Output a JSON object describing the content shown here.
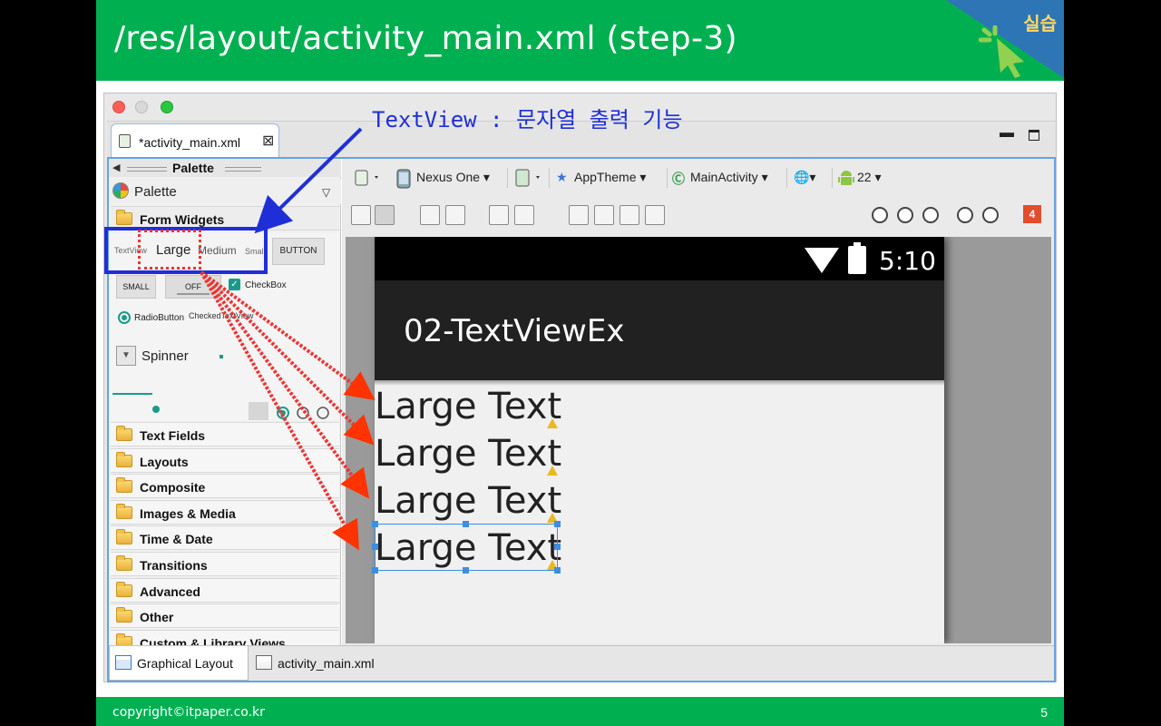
{
  "slide": {
    "title": "/res/layout/activity_main.xml (step-3)",
    "corner_label": "실습",
    "footer_copyright": "copyright©itpaper.co.kr",
    "page_number": "5",
    "annotation_label": "TextView : 문자열 출력 기능",
    "colors": {
      "title_bar": "#00b050",
      "annotation_blue": "#1f2fd8",
      "annotation_red": "#e33333"
    }
  },
  "window": {
    "editor_tab": "*activity_main.xml",
    "palette": {
      "header": "Palette",
      "dropdown": "Palette",
      "form_widgets": "Form Widgets",
      "widgets": {
        "textview": "TextView",
        "large": "Large",
        "medium": "Medium",
        "small": "Small",
        "button": "BUTTON",
        "small_button": "SMALL",
        "toggle": "OFF",
        "checkbox": "CheckBox",
        "radio": "RadioButton",
        "checked_text_view": "CheckedTextView",
        "spinner": "Spinner"
      },
      "folders": [
        "Text Fields",
        "Layouts",
        "Composite",
        "Images & Media",
        "Time & Date",
        "Transitions",
        "Advanced",
        "Other",
        "Custom & Library Views"
      ]
    },
    "toolbar": {
      "device": "Nexus One",
      "theme": "AppTheme",
      "activity": "MainActivity",
      "api_level": "22",
      "error_count": "4"
    },
    "device": {
      "time": "5:10",
      "app_title": "02-TextViewEx",
      "text_views": [
        "Large Text",
        "Large Text",
        "Large Text",
        "Large Text"
      ]
    },
    "bottom_tabs": [
      "Graphical Layout",
      "activity_main.xml"
    ]
  }
}
